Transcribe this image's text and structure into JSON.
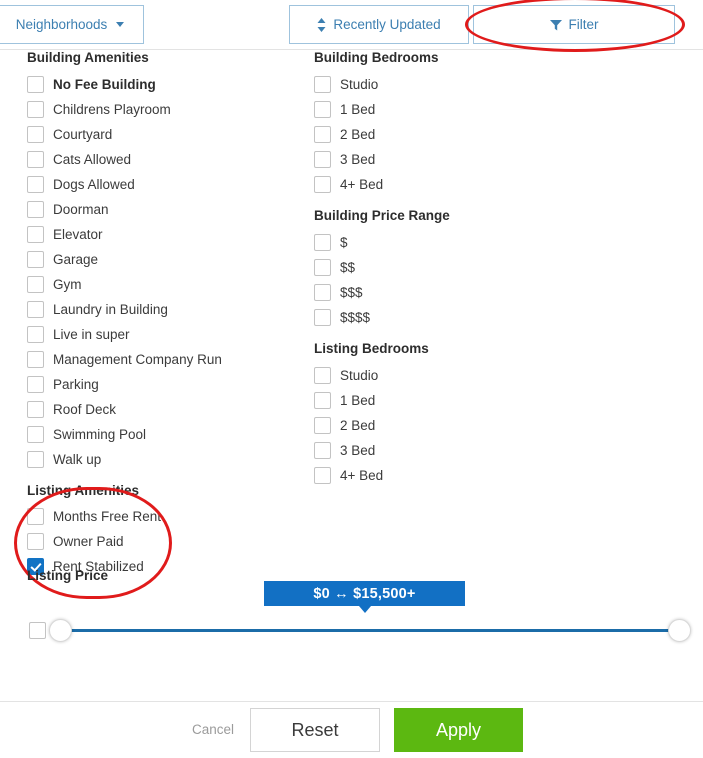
{
  "toolbar": {
    "neighborhoods_label": "Neighborhoods",
    "sort_label": "Recently Updated",
    "filter_label": "Filter"
  },
  "sections": {
    "building_amenities": {
      "title": "Building Amenities",
      "items": [
        {
          "label": "No Fee Building",
          "checked": false,
          "bold": true
        },
        {
          "label": "Childrens Playroom",
          "checked": false,
          "bold": false
        },
        {
          "label": "Courtyard",
          "checked": false,
          "bold": false
        },
        {
          "label": "Cats Allowed",
          "checked": false,
          "bold": false
        },
        {
          "label": "Dogs Allowed",
          "checked": false,
          "bold": false
        },
        {
          "label": "Doorman",
          "checked": false,
          "bold": false
        },
        {
          "label": "Elevator",
          "checked": false,
          "bold": false
        },
        {
          "label": "Garage",
          "checked": false,
          "bold": false
        },
        {
          "label": "Gym",
          "checked": false,
          "bold": false
        },
        {
          "label": "Laundry in Building",
          "checked": false,
          "bold": false
        },
        {
          "label": "Live in super",
          "checked": false,
          "bold": false
        },
        {
          "label": "Management Company Run",
          "checked": false,
          "bold": false
        },
        {
          "label": "Parking",
          "checked": false,
          "bold": false
        },
        {
          "label": "Roof Deck",
          "checked": false,
          "bold": false
        },
        {
          "label": "Swimming Pool",
          "checked": false,
          "bold": false
        },
        {
          "label": "Walk up",
          "checked": false,
          "bold": false
        }
      ]
    },
    "listing_amenities": {
      "title": "Listing Amenities",
      "items": [
        {
          "label": "Months Free Rent",
          "checked": false,
          "bold": false
        },
        {
          "label": "Owner Paid",
          "checked": false,
          "bold": false
        },
        {
          "label": "Rent Stabilized",
          "checked": true,
          "bold": false
        }
      ]
    },
    "building_bedrooms": {
      "title": "Building Bedrooms",
      "items": [
        {
          "label": "Studio",
          "checked": false,
          "bold": false
        },
        {
          "label": "1 Bed",
          "checked": false,
          "bold": false
        },
        {
          "label": "2 Bed",
          "checked": false,
          "bold": false
        },
        {
          "label": "3 Bed",
          "checked": false,
          "bold": false
        },
        {
          "label": "4+ Bed",
          "checked": false,
          "bold": false
        }
      ]
    },
    "building_price_range": {
      "title": "Building Price Range",
      "items": [
        {
          "label": "$",
          "checked": false,
          "bold": false
        },
        {
          "label": "$$",
          "checked": false,
          "bold": false
        },
        {
          "label": "$$$",
          "checked": false,
          "bold": false
        },
        {
          "label": "$$$$",
          "checked": false,
          "bold": false
        }
      ]
    },
    "listing_bedrooms": {
      "title": "Listing Bedrooms",
      "items": [
        {
          "label": "Studio",
          "checked": false,
          "bold": false
        },
        {
          "label": "1 Bed",
          "checked": false,
          "bold": false
        },
        {
          "label": "2 Bed",
          "checked": false,
          "bold": false
        },
        {
          "label": "3 Bed",
          "checked": false,
          "bold": false
        },
        {
          "label": "4+ Bed",
          "checked": false,
          "bold": false
        }
      ]
    }
  },
  "listing_price": {
    "title": "Listing Price",
    "range_label": "$0 ↔ $15,500+",
    "min_value": "$0",
    "max_value": "$15,500+",
    "enabled": false
  },
  "footer": {
    "cancel_label": "Cancel",
    "reset_label": "Reset",
    "apply_label": "Apply"
  },
  "colors": {
    "accent_blue": "#1273c4",
    "link_blue": "#3c7fb1",
    "apply_green": "#5cb811",
    "annotation_red": "#e01b1b"
  }
}
